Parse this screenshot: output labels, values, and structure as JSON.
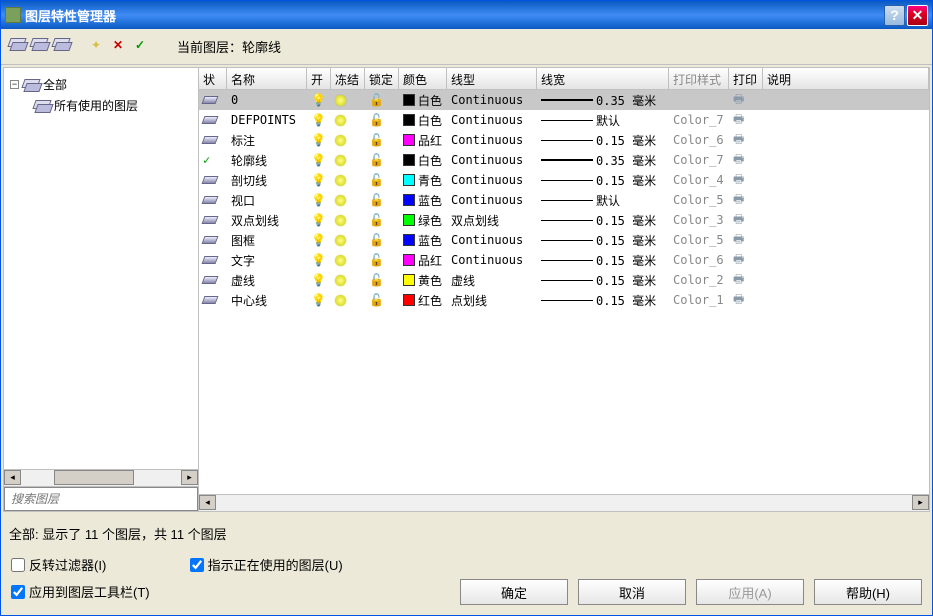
{
  "title": "图层特性管理器",
  "current_layer_label": "当前图层：轮廓线",
  "tree": {
    "root": {
      "label": "全部"
    },
    "child": {
      "label": "所有使用的图层"
    }
  },
  "search": {
    "placeholder": "搜索图层"
  },
  "columns": {
    "status": "状",
    "name": "名称",
    "on": "开",
    "freeze": "冻结",
    "lock": "锁定",
    "color": "颜色",
    "linetype": "线型",
    "lineweight": "线宽",
    "plotstyle": "打印样式",
    "plot": "打印",
    "desc": "说明"
  },
  "layers": [
    {
      "current": false,
      "name": "0",
      "color": "白色",
      "swatch": "#000000",
      "ltype": "Continuous",
      "lw": "0.35 毫米",
      "lw_thick": true,
      "pstyle": "",
      "selected": true
    },
    {
      "current": false,
      "name": "DEFPOINTS",
      "color": "白色",
      "swatch": "#000000",
      "ltype": "Continuous",
      "lw": "默认",
      "lw_thick": false,
      "pstyle": "Color_7"
    },
    {
      "current": false,
      "name": "标注",
      "color": "品红",
      "swatch": "#ff00ff",
      "ltype": "Continuous",
      "lw": "0.15 毫米",
      "lw_thick": false,
      "pstyle": "Color_6"
    },
    {
      "current": true,
      "name": "轮廓线",
      "color": "白色",
      "swatch": "#000000",
      "ltype": "Continuous",
      "lw": "0.35 毫米",
      "lw_thick": true,
      "pstyle": "Color_7"
    },
    {
      "current": false,
      "name": "剖切线",
      "color": "青色",
      "swatch": "#00ffff",
      "ltype": "Continuous",
      "lw": "0.15 毫米",
      "lw_thick": false,
      "pstyle": "Color_4"
    },
    {
      "current": false,
      "name": "视口",
      "color": "蓝色",
      "swatch": "#0000ff",
      "ltype": "Continuous",
      "lw": "默认",
      "lw_thick": false,
      "pstyle": "Color_5"
    },
    {
      "current": false,
      "name": "双点划线",
      "color": "绿色",
      "swatch": "#00ff00",
      "ltype": "双点划线",
      "lw": "0.15 毫米",
      "lw_thick": false,
      "pstyle": "Color_3"
    },
    {
      "current": false,
      "name": "图框",
      "color": "蓝色",
      "swatch": "#0000ff",
      "ltype": "Continuous",
      "lw": "0.15 毫米",
      "lw_thick": false,
      "pstyle": "Color_5"
    },
    {
      "current": false,
      "name": "文字",
      "color": "品红",
      "swatch": "#ff00ff",
      "ltype": "Continuous",
      "lw": "0.15 毫米",
      "lw_thick": false,
      "pstyle": "Color_6"
    },
    {
      "current": false,
      "name": "虚线",
      "color": "黄色",
      "swatch": "#ffff00",
      "ltype": "虚线",
      "lw": "0.15 毫米",
      "lw_thick": false,
      "pstyle": "Color_2"
    },
    {
      "current": false,
      "name": "中心线",
      "color": "红色",
      "swatch": "#ff0000",
      "ltype": "点划线",
      "lw": "0.15 毫米",
      "lw_thick": false,
      "pstyle": "Color_1"
    }
  ],
  "status_text": "全部: 显示了 11 个图层，共 11 个图层",
  "checkboxes": {
    "invert": {
      "label": "反转过滤器(I)",
      "checked": false
    },
    "indicate": {
      "label": "指示正在使用的图层(U)",
      "checked": true
    },
    "apply_toolbar": {
      "label": "应用到图层工具栏(T)",
      "checked": true
    }
  },
  "buttons": {
    "ok": "确定",
    "cancel": "取消",
    "apply": "应用(A)",
    "help": "帮助(H)"
  }
}
